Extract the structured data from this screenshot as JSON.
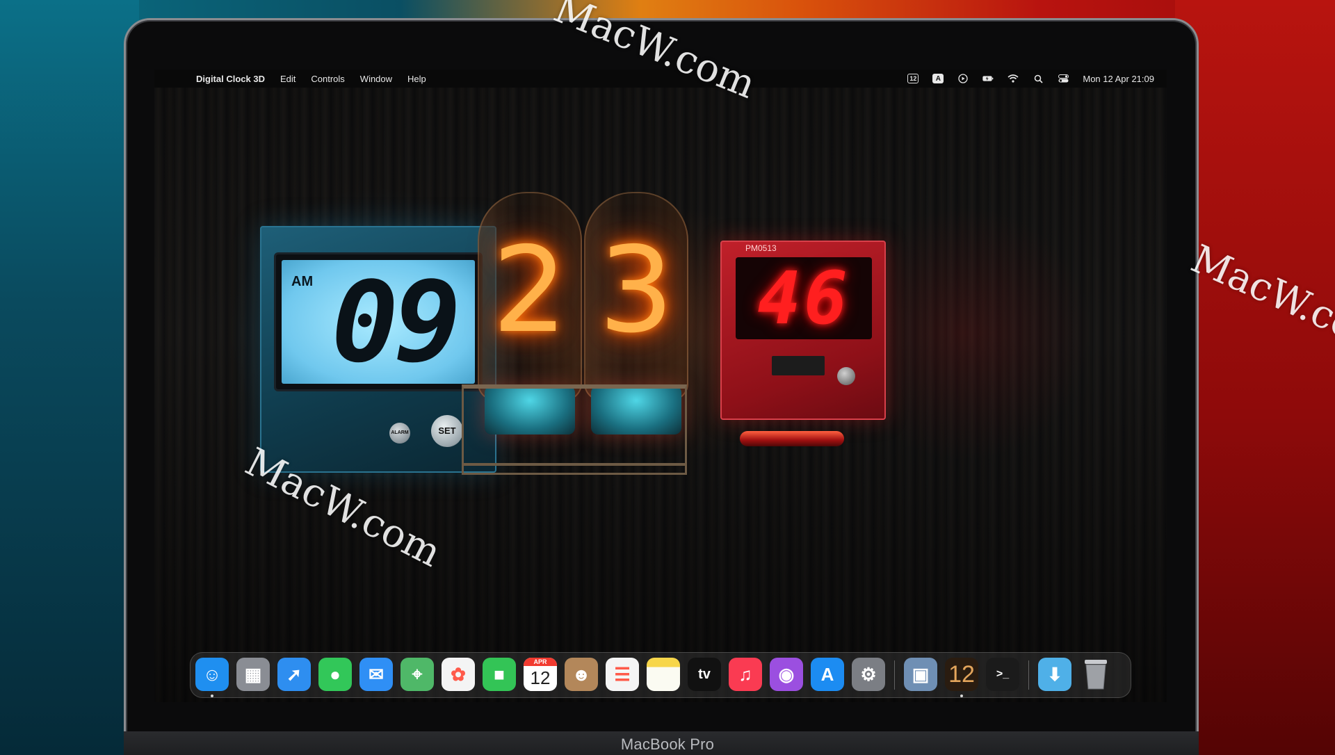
{
  "menubar": {
    "app_name": "Digital Clock 3D",
    "items": [
      "Edit",
      "Controls",
      "Window",
      "Help"
    ],
    "status_icons": [
      "calendar-12-icon",
      "input-source-a-icon",
      "play-icon",
      "battery-charging-icon",
      "wifi-icon",
      "search-icon",
      "control-center-icon"
    ],
    "calendar_icon_text": "12",
    "input_source_text": "A",
    "datetime": "Mon 12 Apr  21:09"
  },
  "clock": {
    "period": "AM",
    "hours": "09",
    "minutes": "23",
    "minute_tens": "2",
    "minute_ones": "3",
    "seconds": "46",
    "set_button": "SET",
    "alarm_button": "ALARM",
    "red_board_label": "PM0513"
  },
  "dock": {
    "apps": [
      {
        "name": "Finder",
        "icon": "finder-icon",
        "color": "#1f8ff0",
        "glyph": "☺"
      },
      {
        "name": "Launchpad",
        "icon": "launchpad-icon",
        "color": "#8a8d94",
        "glyph": "▦"
      },
      {
        "name": "Safari",
        "icon": "safari-icon",
        "color": "#2e8ef0",
        "glyph": "➚"
      },
      {
        "name": "Messages",
        "icon": "messages-icon",
        "color": "#32c759",
        "glyph": "●"
      },
      {
        "name": "Mail",
        "icon": "mail-icon",
        "color": "#2f8ff5",
        "glyph": "✉"
      },
      {
        "name": "Maps",
        "icon": "maps-icon",
        "color": "#4fb868",
        "glyph": "⌖"
      },
      {
        "name": "Photos",
        "icon": "photos-icon",
        "color": "#f4f4f4",
        "glyph": "✿"
      },
      {
        "name": "FaceTime",
        "icon": "facetime-icon",
        "color": "#33c456",
        "glyph": "■"
      },
      {
        "name": "Calendar",
        "icon": "calendar-icon",
        "color": "#ffffff",
        "glyph": ""
      },
      {
        "name": "Contacts",
        "icon": "contacts-icon",
        "color": "#b3875a",
        "glyph": "☻"
      },
      {
        "name": "Reminders",
        "icon": "reminders-icon",
        "color": "#f5f5f5",
        "glyph": "☰"
      },
      {
        "name": "Notes",
        "icon": "notes-icon",
        "color": "#f7d64a",
        "glyph": ""
      },
      {
        "name": "Apple TV",
        "icon": "appletv-icon",
        "color": "#111111",
        "glyph": ""
      },
      {
        "name": "Music",
        "icon": "music-icon",
        "color": "#fa3b52",
        "glyph": "♫"
      },
      {
        "name": "Podcasts",
        "icon": "podcasts-icon",
        "color": "#9b4fe0",
        "glyph": "◉"
      },
      {
        "name": "App Store",
        "icon": "appstore-icon",
        "color": "#1c8cf2",
        "glyph": "A"
      },
      {
        "name": "System Preferences",
        "icon": "system-preferences-icon",
        "color": "#7b7e84",
        "glyph": "⚙"
      }
    ],
    "recent_apps": [
      {
        "name": "Preview",
        "icon": "preview-icon",
        "color": "#6f8fb4",
        "glyph": "▣"
      },
      {
        "name": "Digital Clock 3D",
        "icon": "digital-clock-icon",
        "color": "#2a1c10",
        "glyph": "12"
      },
      {
        "name": "Terminal",
        "icon": "terminal-icon",
        "color": "#1b1b1b",
        "glyph": ">_"
      }
    ],
    "folders": [
      {
        "name": "Downloads",
        "icon": "downloads-folder-icon",
        "color": "#4fb0e8",
        "glyph": "⬇"
      },
      {
        "name": "Trash",
        "icon": "trash-icon",
        "color": "#8d8f93",
        "glyph": ""
      }
    ],
    "calendar_month": "APR",
    "calendar_day": "12",
    "appletv_label": "tv"
  },
  "device_label": "MacBook Pro",
  "watermark": "MacW.com",
  "colors": {
    "lcd_backlight": "#8fdcff",
    "nixie_glow": "#ff8a20",
    "led_red": "#ff1f1f"
  }
}
